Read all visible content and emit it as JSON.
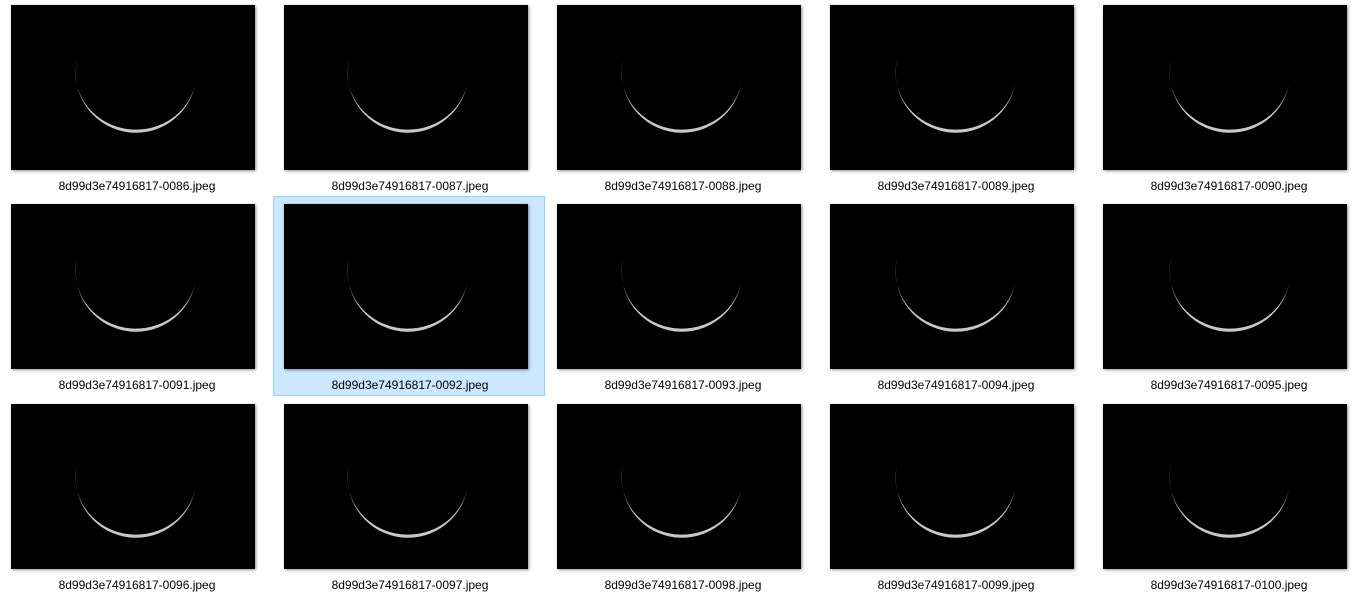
{
  "files": [
    {
      "name": "8d99d3e74916817-0086.jpeg",
      "selected": false
    },
    {
      "name": "8d99d3e74916817-0087.jpeg",
      "selected": false
    },
    {
      "name": "8d99d3e74916817-0088.jpeg",
      "selected": false
    },
    {
      "name": "8d99d3e74916817-0089.jpeg",
      "selected": false
    },
    {
      "name": "8d99d3e74916817-0090.jpeg",
      "selected": false
    },
    {
      "name": "8d99d3e74916817-0091.jpeg",
      "selected": false
    },
    {
      "name": "8d99d3e74916817-0092.jpeg",
      "selected": true
    },
    {
      "name": "8d99d3e74916817-0093.jpeg",
      "selected": false
    },
    {
      "name": "8d99d3e74916817-0094.jpeg",
      "selected": false
    },
    {
      "name": "8d99d3e74916817-0095.jpeg",
      "selected": false
    },
    {
      "name": "8d99d3e74916817-0096.jpeg",
      "selected": false
    },
    {
      "name": "8d99d3e74916817-0097.jpeg",
      "selected": false
    },
    {
      "name": "8d99d3e74916817-0098.jpeg",
      "selected": false
    },
    {
      "name": "8d99d3e74916817-0099.jpeg",
      "selected": false
    },
    {
      "name": "8d99d3e74916817-0100.jpeg",
      "selected": false
    }
  ],
  "colors": {
    "selection_fill": "#cce8ff",
    "selection_border": "#99d1ff",
    "photo_background": "#000000",
    "moon": "#d9d9d9"
  },
  "thumbnail_icon": "crescent-moon-photo"
}
